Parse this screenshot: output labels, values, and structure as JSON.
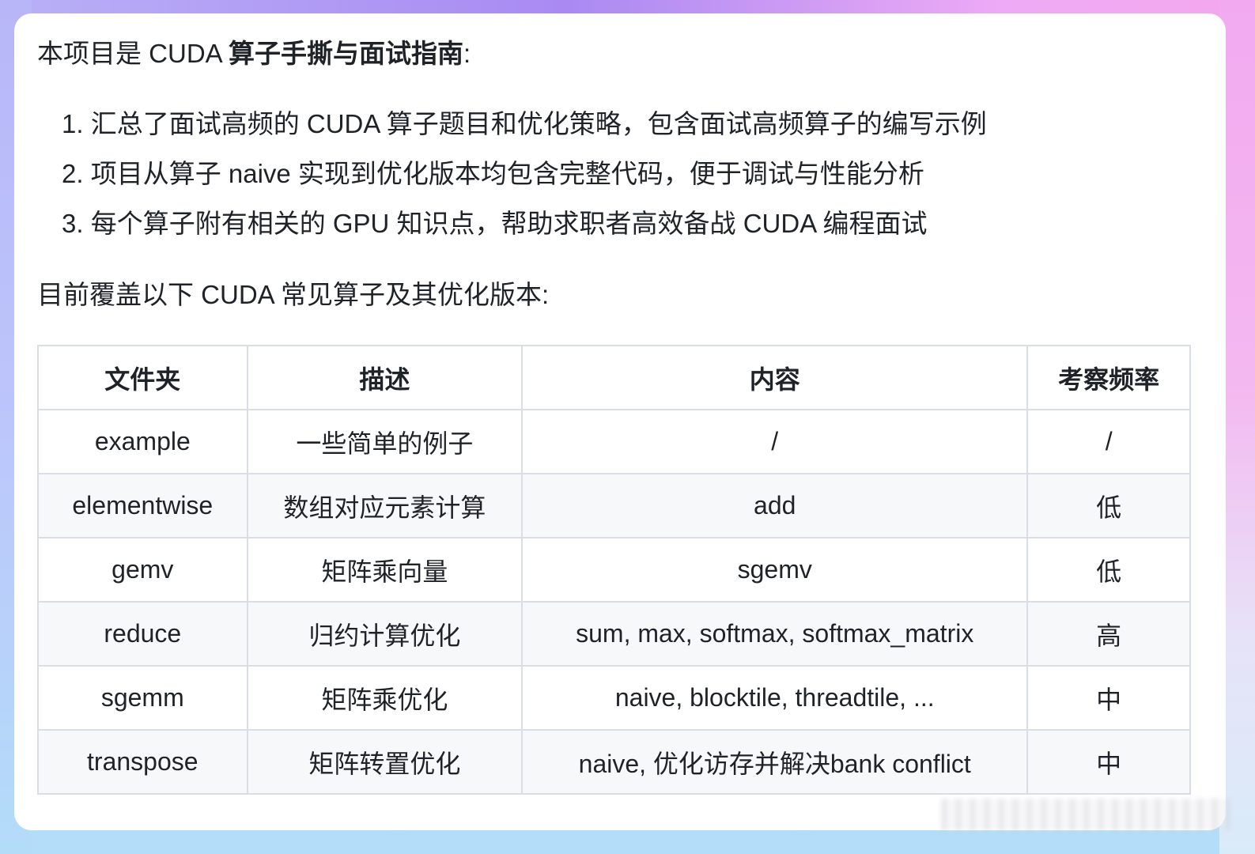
{
  "intro": {
    "prefix": "本项目是 CUDA ",
    "emphasis": "算子手撕与面试指南",
    "suffix": ":"
  },
  "features": [
    "1. 汇总了面试高频的 CUDA 算子题目和优化策略，包含面试高频算子的编写示例",
    "2. 项目从算子 naive 实现到优化版本均包含完整代码，便于调试与性能分析",
    "3. 每个算子附有相关的 GPU 知识点，帮助求职者高效备战 CUDA 编程面试"
  ],
  "coverage_text": "目前覆盖以下 CUDA 常见算子及其优化版本:",
  "table": {
    "headers": [
      "文件夹",
      "描述",
      "内容",
      "考察频率"
    ],
    "rows": [
      [
        "example",
        "一些简单的例子",
        "/",
        "/"
      ],
      [
        "elementwise",
        "数组对应元素计算",
        "add",
        "低"
      ],
      [
        "gemv",
        "矩阵乘向量",
        "sgemv",
        "低"
      ],
      [
        "reduce",
        "归约计算优化",
        "sum, max, softmax, softmax_matrix",
        "高"
      ],
      [
        "sgemm",
        "矩阵乘优化",
        "naive, blocktile, threadtile, ...",
        "中"
      ],
      [
        "transpose",
        "矩阵转置优化",
        "naive, 优化访存并解决bank conflict",
        "中"
      ]
    ]
  },
  "colors": {
    "text": "#1f2328",
    "border": "#d8dee4",
    "row_alt": "#f6f8fa",
    "card": "#ffffff",
    "bg_purple": "#a98af2",
    "bg_pink": "#f4a8ec",
    "bg_blue": "#b5dcf8"
  }
}
